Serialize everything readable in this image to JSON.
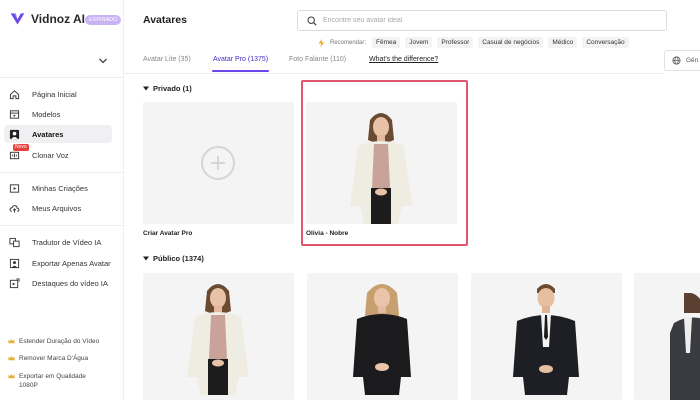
{
  "brand": {
    "name": "Vidnoz AI",
    "badge": "EXPIRADO",
    "accent": "#6a46e8"
  },
  "sidebar": {
    "items": [
      {
        "label": "Página Inicial",
        "icon": "home-icon"
      },
      {
        "label": "Modelos",
        "icon": "templates-icon"
      },
      {
        "label": "Avatares",
        "icon": "avatar-icon",
        "active": true
      },
      {
        "label": "Clonar Voz",
        "icon": "voice-clone-icon",
        "badge": "Novo"
      },
      {
        "label": "Minhas Criações",
        "icon": "play-icon"
      },
      {
        "label": "Meus Arquivos",
        "icon": "cloud-icon"
      },
      {
        "label": "Tradutor de Vídeo IA",
        "icon": "translate-icon"
      },
      {
        "label": "Exportar Apenas Avatar",
        "icon": "export-avatar-icon"
      },
      {
        "label": "Destaques do vídeo IA",
        "icon": "highlights-icon"
      }
    ],
    "upgrades": [
      {
        "label": "Estender Duração do Vídeo"
      },
      {
        "label": "Remover Marca D'Água"
      },
      {
        "label": "Exportar em Qualidade 1080P"
      }
    ]
  },
  "header": {
    "title": "Avatares",
    "search_placeholder": "Encontre seu avatar ideal",
    "recommend_label": "Recomendar:",
    "chips": [
      "Fêmea",
      "Jovem",
      "Professor",
      "Casual de negócios",
      "Médico",
      "Conversação"
    ],
    "language_label": "Gên"
  },
  "tabs": [
    {
      "label": "Avatar Lite (35)"
    },
    {
      "label": "Avatar Pro (1375)",
      "active": true
    },
    {
      "label": "Foto Falante (110)"
    },
    {
      "label": "What's the difference?"
    }
  ],
  "private_section": {
    "title": "Privado (1)",
    "cards": [
      {
        "label": "Criar Avatar Pro"
      },
      {
        "label": "Olivia - Nobre",
        "selected": true
      }
    ]
  },
  "public_section": {
    "title": "Público (1374)"
  }
}
